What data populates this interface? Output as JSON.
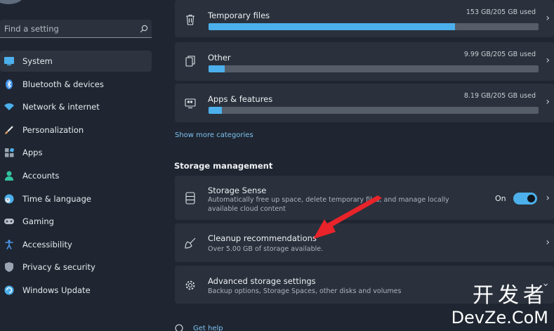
{
  "sidebar": {
    "search_placeholder": "Find a setting",
    "items": [
      {
        "label": "System",
        "icon": "monitor-icon",
        "color": "#4cb0ec",
        "active": true
      },
      {
        "label": "Bluetooth & devices",
        "icon": "bluetooth-icon",
        "color": "#3b8ee8"
      },
      {
        "label": "Network & internet",
        "icon": "wifi-icon",
        "color": "#4cb0ec"
      },
      {
        "label": "Personalization",
        "icon": "brush-icon",
        "color": "#e09a5a"
      },
      {
        "label": "Apps",
        "icon": "apps-icon",
        "color": "#9aa4b2"
      },
      {
        "label": "Accounts",
        "icon": "person-icon",
        "color": "#33c4a0"
      },
      {
        "label": "Time & language",
        "icon": "globe-clock-icon",
        "color": "#4cb0ec"
      },
      {
        "label": "Gaming",
        "icon": "gamepad-icon",
        "color": "#b8bec7"
      },
      {
        "label": "Accessibility",
        "icon": "accessibility-icon",
        "color": "#4c9cf0"
      },
      {
        "label": "Privacy & security",
        "icon": "shield-icon",
        "color": "#9aa4b2"
      },
      {
        "label": "Windows Update",
        "icon": "update-icon",
        "color": "#4cb0ec"
      }
    ]
  },
  "storage_categories": [
    {
      "name": "Temporary files",
      "usage": "153 GB/205 GB used",
      "fill": 0.746,
      "icon": "trash-icon"
    },
    {
      "name": "Other",
      "usage": "9.99 GB/205 GB used",
      "fill": 0.049,
      "icon": "document-icon"
    },
    {
      "name": "Apps & features",
      "usage": "8.19 GB/205 GB used",
      "fill": 0.04,
      "icon": "apps-features-icon"
    }
  ],
  "show_more": "Show more categories",
  "section_title": "Storage management",
  "storage_sense": {
    "title": "Storage Sense",
    "desc_line1": "Automatically free up space, delete temporary files, and manage locally",
    "desc_line2": "available cloud content",
    "toggle_label": "On"
  },
  "cleanup": {
    "title": "Cleanup recommendations",
    "desc": "Over 5.00 GB of storage available."
  },
  "advanced": {
    "title": "Advanced storage settings",
    "desc": "Backup options, Storage Spaces, other disks and volumes"
  },
  "help": "Get help",
  "watermark": {
    "cn": "开发者",
    "en": "DevZe.CoM"
  },
  "colors": {
    "accent": "#4cb0ec",
    "arrow": "#e8232a",
    "link": "#7dc2f0"
  }
}
